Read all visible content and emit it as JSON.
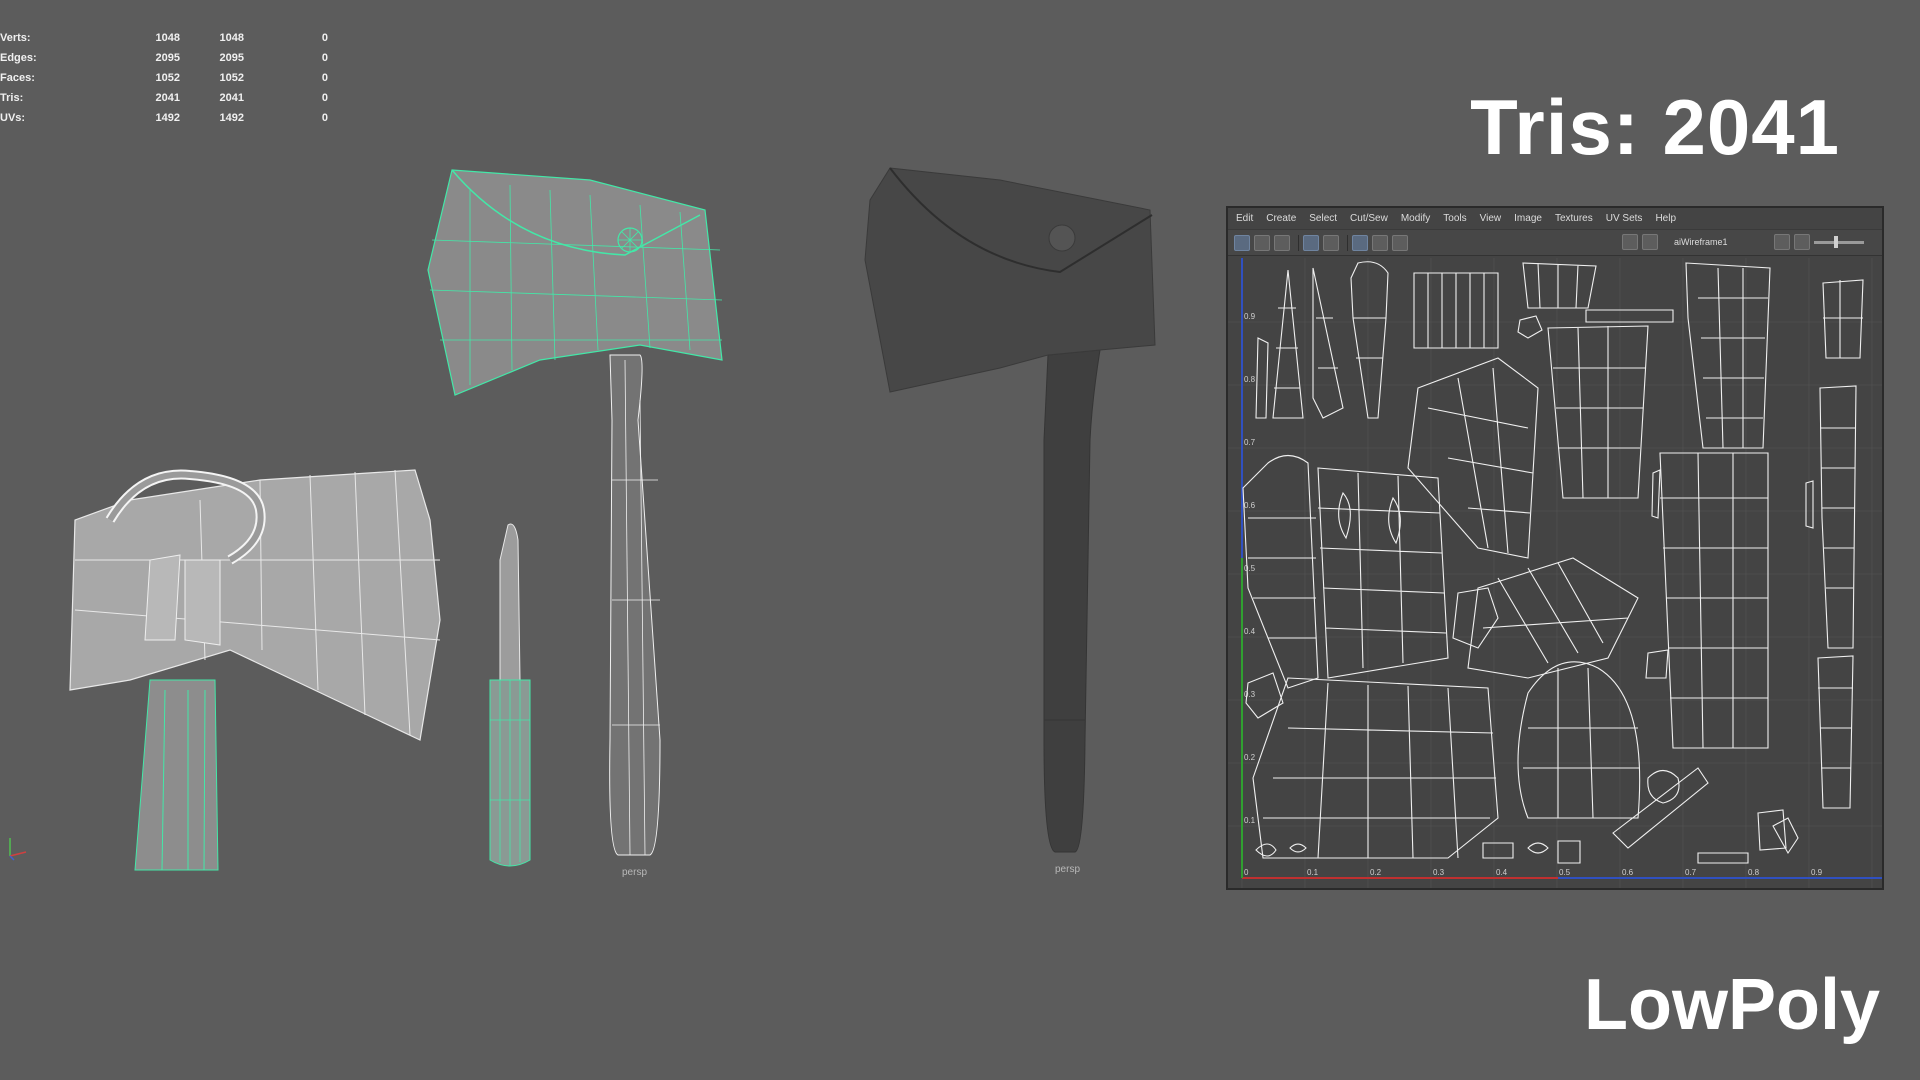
{
  "stats": {
    "rows": [
      {
        "label": "Verts:",
        "v1": "1048",
        "v2": "1048",
        "v3": "0"
      },
      {
        "label": "Edges:",
        "v1": "2095",
        "v2": "2095",
        "v3": "0"
      },
      {
        "label": "Faces:",
        "v1": "1052",
        "v2": "1052",
        "v3": "0"
      },
      {
        "label": "Tris:",
        "v1": "2041",
        "v2": "2041",
        "v3": "0"
      },
      {
        "label": "UVs:",
        "v1": "1492",
        "v2": "1492",
        "v3": "0"
      }
    ]
  },
  "headline": "Tris: 2041",
  "footer": "LowPoly",
  "viewports": {
    "wireframe_label": "persp",
    "shaded_label": "persp"
  },
  "uv_editor": {
    "menus": [
      "Edit",
      "Create",
      "Select",
      "Cut/Sew",
      "Modify",
      "Tools",
      "View",
      "Image",
      "Textures",
      "UV Sets",
      "Help"
    ],
    "image_field": "aiWireframe1",
    "x_ticks": [
      "0",
      "0.1",
      "0.2",
      "0.3",
      "0.4",
      "0.5",
      "0.6",
      "0.7",
      "0.8",
      "0.9"
    ],
    "y_ticks": [
      "0.9",
      "0.8",
      "0.7",
      "0.6",
      "0.5",
      "0.4",
      "0.3",
      "0.2",
      "0.1"
    ]
  },
  "colors": {
    "background": "#5c5c5c",
    "selection_wire": "#43e8a8",
    "wire": "#e8e8e8",
    "uv_x_axis": "#c03030",
    "uv_y_axis": "#30a030"
  }
}
